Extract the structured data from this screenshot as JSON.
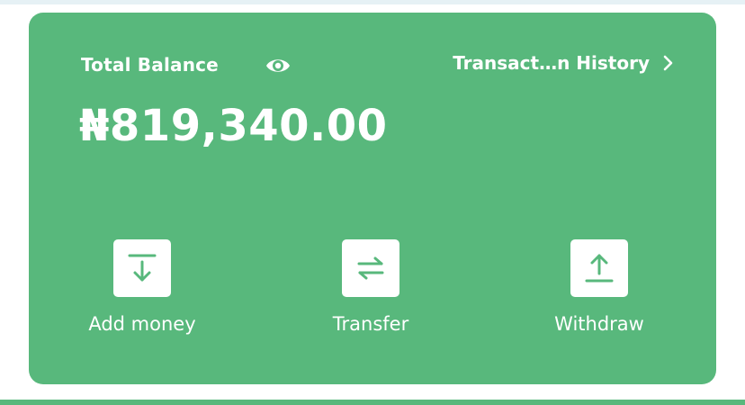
{
  "wallet": {
    "balance_label": "Total Balance",
    "visibility_icon": "eye-icon",
    "history_link_label": "Transact…n History",
    "history_icon": "chevron-right-icon",
    "amount": "₦819,340.00"
  },
  "actions": [
    {
      "label": "Add money",
      "icon": "download-arrow-icon"
    },
    {
      "label": "Transfer",
      "icon": "swap-arrows-icon"
    },
    {
      "label": "Withdraw",
      "icon": "upload-arrow-icon"
    }
  ],
  "colors": {
    "card": "#58b87c",
    "text": "#ffffff",
    "icon": "#58b87c",
    "top_strip": "#e6f1f5"
  }
}
